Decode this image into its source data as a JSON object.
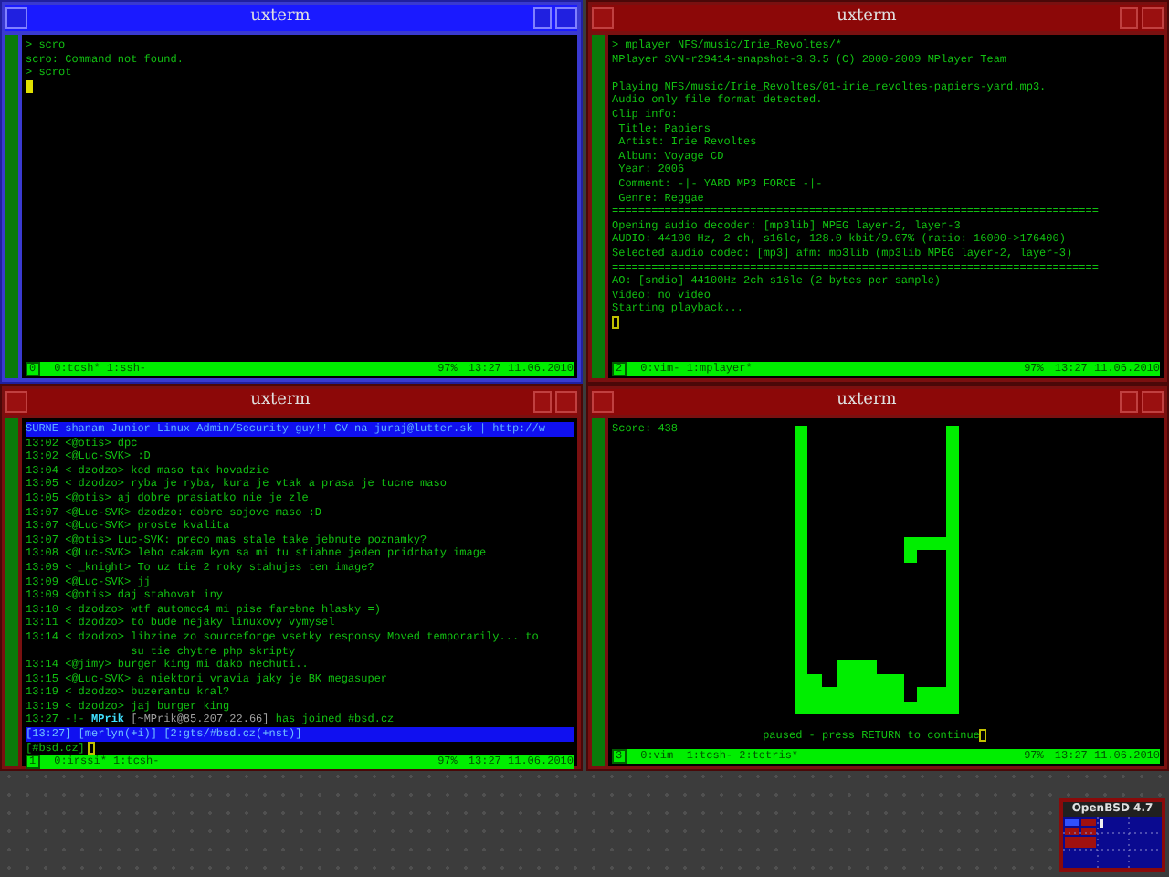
{
  "windows": [
    {
      "title": "uxterm",
      "focused": true,
      "kind": "shell",
      "blocks": [
        [
          "> scro",
          "scro: Command not found.",
          "> scrot"
        ]
      ],
      "status": {
        "number": "0",
        "tabs": "0:tcsh* 1:ssh-",
        "battery": "97%",
        "clock": "13:27 11.06.2010"
      }
    },
    {
      "title": "uxterm",
      "focused": false,
      "kind": "shell",
      "blocks": [
        [
          "> mplayer NFS/music/Irie_Revoltes/*",
          "MPlayer SVN-r29414-snapshot-3.3.5 (C) 2000-2009 MPlayer Team"
        ],
        [
          "Playing NFS/music/Irie_Revoltes/01-irie_revoltes-papiers-yard.mp3.",
          "Audio only file format detected.",
          "Clip info:",
          " Title: Papiers",
          " Artist: Irie Revoltes",
          " Album: Voyage CD",
          " Year: 2006",
          " Comment: -|- YARD MP3 FORCE -|-",
          " Genre: Reggae",
          "==========================================================================",
          "Opening audio decoder: [mp3lib] MPEG layer-2, layer-3",
          "AUDIO: 44100 Hz, 2 ch, s16le, 128.0 kbit/9.07% (ratio: 16000->176400)",
          "Selected audio codec: [mp3] afm: mp3lib (mp3lib MPEG layer-2, layer-3)",
          "==========================================================================",
          "AO: [sndio] 44100Hz 2ch s16le (2 bytes per sample)",
          "Video: no video",
          "Starting playback..."
        ]
      ],
      "status": {
        "number": "2",
        "tabs": "0:vim- 1:mplayer*",
        "battery": "97%",
        "clock": "13:27 11.06.2010"
      }
    },
    {
      "title": "uxterm",
      "focused": false,
      "kind": "irc",
      "topic": "SURNE shanam Junior Linux Admin/Security guy!! CV na juraj@lutter.sk | http://w",
      "lines": [
        {
          "kind": "message",
          "text": "13:02 <@otis> dpc"
        },
        {
          "kind": "message",
          "text": "13:02 <@Luc-SVK> :D"
        },
        {
          "kind": "message",
          "text": "13:04 < dzodzo> ked maso tak hovadzie"
        },
        {
          "kind": "message",
          "text": "13:05 < dzodzo> ryba je ryba, kura je vtak a prasa je tucne maso"
        },
        {
          "kind": "message",
          "text": "13:05 <@otis> aj dobre prasiatko nie je zle"
        },
        {
          "kind": "message",
          "text": "13:07 <@Luc-SVK> dzodzo: dobre sojove maso :D"
        },
        {
          "kind": "message",
          "text": "13:07 <@Luc-SVK> proste kvalita"
        },
        {
          "kind": "message",
          "text": "13:07 <@otis> Luc-SVK: preco mas stale take jebnute poznamky?"
        },
        {
          "kind": "message",
          "text": "13:08 <@Luc-SVK> lebo cakam kym sa mi tu stiahne jeden pridrbaty image"
        },
        {
          "kind": "message",
          "text": "13:09 < _knight> To uz tie 2 roky stahujes ten image?"
        },
        {
          "kind": "message",
          "text": "13:09 <@Luc-SVK> jj"
        },
        {
          "kind": "message",
          "text": "13:09 <@otis> daj stahovat iny"
        },
        {
          "kind": "message",
          "text": "13:10 < dzodzo> wtf automoc4 mi pise farebne hlasky =)"
        },
        {
          "kind": "message",
          "text": "13:11 < dzodzo> to bude nejaky linuxovy vymysel"
        },
        {
          "kind": "message",
          "text": "13:14 < dzodzo> libzine zo sourceforge vsetky responsy Moved temporarily... to"
        },
        {
          "kind": "message",
          "text": "                su tie chytre php skripty"
        },
        {
          "kind": "message",
          "text": "13:14 <@jimy> burger king mi dako nechuti.."
        },
        {
          "kind": "message",
          "text": "13:15 <@Luc-SVK> a niektori vravia jaky je BK megasuper"
        },
        {
          "kind": "message",
          "text": "13:19 < dzodzo> buzerantu kral?"
        },
        {
          "kind": "message",
          "text": "13:19 < dzodzo> jaj burger king"
        },
        {
          "kind": "join",
          "prefix": "13:27 -!- ",
          "nick": "MPrik",
          "host": " [~MPrik@85.207.22.66]",
          "text": " has joined #bsd.cz"
        }
      ],
      "irc_status": "[13:27] [merlyn(+i)] [2:gts/#bsd.cz(+nst)]",
      "input_prompt": "[#bsd.cz]",
      "status": {
        "number": "1",
        "tabs": "0:irssi* 1:tcsh-",
        "battery": "97%",
        "clock": "13:27 11.06.2010"
      }
    },
    {
      "title": "uxterm",
      "focused": false,
      "kind": "tetris",
      "score": "Score: 438",
      "message": "paused - press RETURN to continue",
      "status": {
        "number": "3",
        "tabs": "0:vim  1:tcsh- 2:tetris*",
        "battery": "97%",
        "clock": "13:27 11.06.2010"
      }
    }
  ],
  "pager": {
    "title": "OpenBSD 4.7"
  }
}
